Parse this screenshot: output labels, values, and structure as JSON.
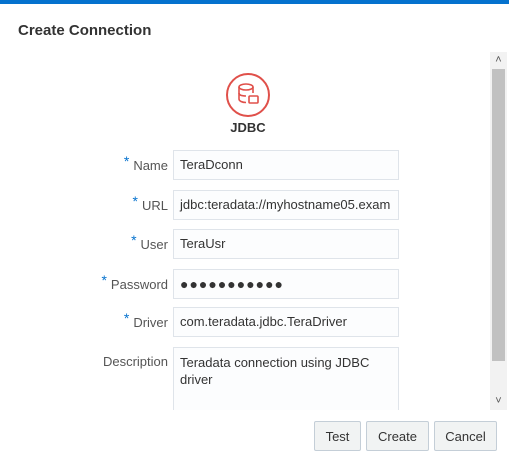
{
  "dialog": {
    "title": "Create Connection"
  },
  "connection_type": {
    "label": "JDBC",
    "icon": "database-icon",
    "accent": "#e0504a"
  },
  "form": {
    "required_marker": "*",
    "name": {
      "label": "Name",
      "value": "TeraDconn"
    },
    "url": {
      "label": "URL",
      "value": "jdbc:teradata://myhostname05.exam"
    },
    "user": {
      "label": "User",
      "value": "TeraUsr"
    },
    "password": {
      "label": "Password",
      "value": "●●●●●●●●●●●"
    },
    "driver": {
      "label": "Driver",
      "value": "com.teradata.jdbc.TeraDriver"
    },
    "description": {
      "label": "Description",
      "value": "Teradata connection using JDBC driver"
    }
  },
  "buttons": {
    "test": "Test",
    "create": "Create",
    "cancel": "Cancel"
  },
  "colors": {
    "accent": "#0572ce",
    "required": "#0572ce"
  }
}
